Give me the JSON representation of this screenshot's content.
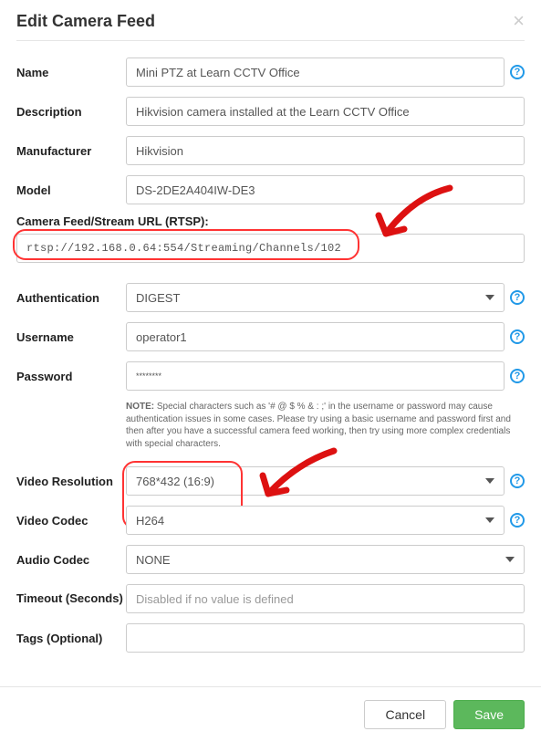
{
  "modal": {
    "title": "Edit Camera Feed"
  },
  "fields": {
    "name": {
      "label": "Name",
      "value": "Mini PTZ at Learn CCTV Office"
    },
    "description": {
      "label": "Description",
      "value": "Hikvision camera installed at the Learn CCTV Office"
    },
    "manufacturer": {
      "label": "Manufacturer",
      "value": "Hikvision"
    },
    "model": {
      "label": "Model",
      "value": "DS-2DE2A404IW-DE3"
    },
    "url": {
      "label": "Camera Feed/Stream URL (RTSP):",
      "value": "rtsp://192.168.0.64:554/Streaming/Channels/102"
    },
    "authentication": {
      "label": "Authentication",
      "value": "DIGEST"
    },
    "username": {
      "label": "Username",
      "value": "operator1"
    },
    "password": {
      "label": "Password",
      "value": "********"
    },
    "resolution": {
      "label": "Video Resolution",
      "value": "768*432 (16:9)"
    },
    "codec": {
      "label": "Video Codec",
      "value": "H264"
    },
    "audio_codec": {
      "label": "Audio Codec",
      "value": "NONE"
    },
    "timeout": {
      "label": "Timeout (Seconds)",
      "placeholder": "Disabled if no value is defined"
    },
    "tags": {
      "label": "Tags (Optional)"
    }
  },
  "note": {
    "prefix": "NOTE:",
    "text": " Special characters such as '# @ $ % & : ;' in the username or password may cause authentication issues in some cases. Please try using a basic username and password first and then after you have a successful camera feed working, then try using more complex credentials with special characters."
  },
  "footer": {
    "cancel": "Cancel",
    "save": "Save"
  }
}
